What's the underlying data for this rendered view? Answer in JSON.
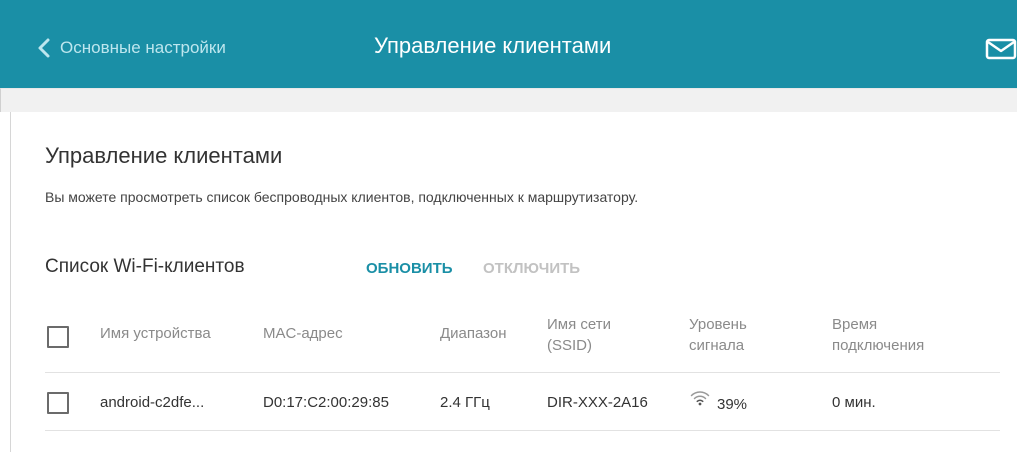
{
  "header": {
    "back_label": "Основные настройки",
    "title": "Управление клиентами"
  },
  "page": {
    "title": "Управление клиентами",
    "description": "Вы можете просмотреть список беспроводных клиентов, подключенных к маршрутизатору."
  },
  "wifi_list": {
    "title": "Список Wi-Fi-клиентов",
    "refresh_label": "ОБНОВИТЬ",
    "disconnect_label": "ОТКЛЮЧИТЬ",
    "columns": {
      "device_name": "Имя устройства",
      "mac": "MAC-адрес",
      "band": "Диапазон",
      "ssid_line1": "Имя сети",
      "ssid_line2": "(SSID)",
      "signal_line1": "Уровень",
      "signal_line2": "сигнала",
      "time_line1": "Время",
      "time_line2": "подключения"
    },
    "rows": [
      {
        "device_name": "android-c2dfe...",
        "mac": "D0:17:C2:00:29:85",
        "band": "2.4 ГГц",
        "ssid": "DIR-XXX-2A16",
        "signal": "39%",
        "time": "0 мин."
      }
    ]
  },
  "colors": {
    "header_bg": "#1a8fa6",
    "accent": "#1a8fa6",
    "disabled": "#c2c2c2"
  },
  "icons": {
    "back": "chevron-left-icon",
    "mail": "mail-icon",
    "signal": "wifi-icon"
  }
}
